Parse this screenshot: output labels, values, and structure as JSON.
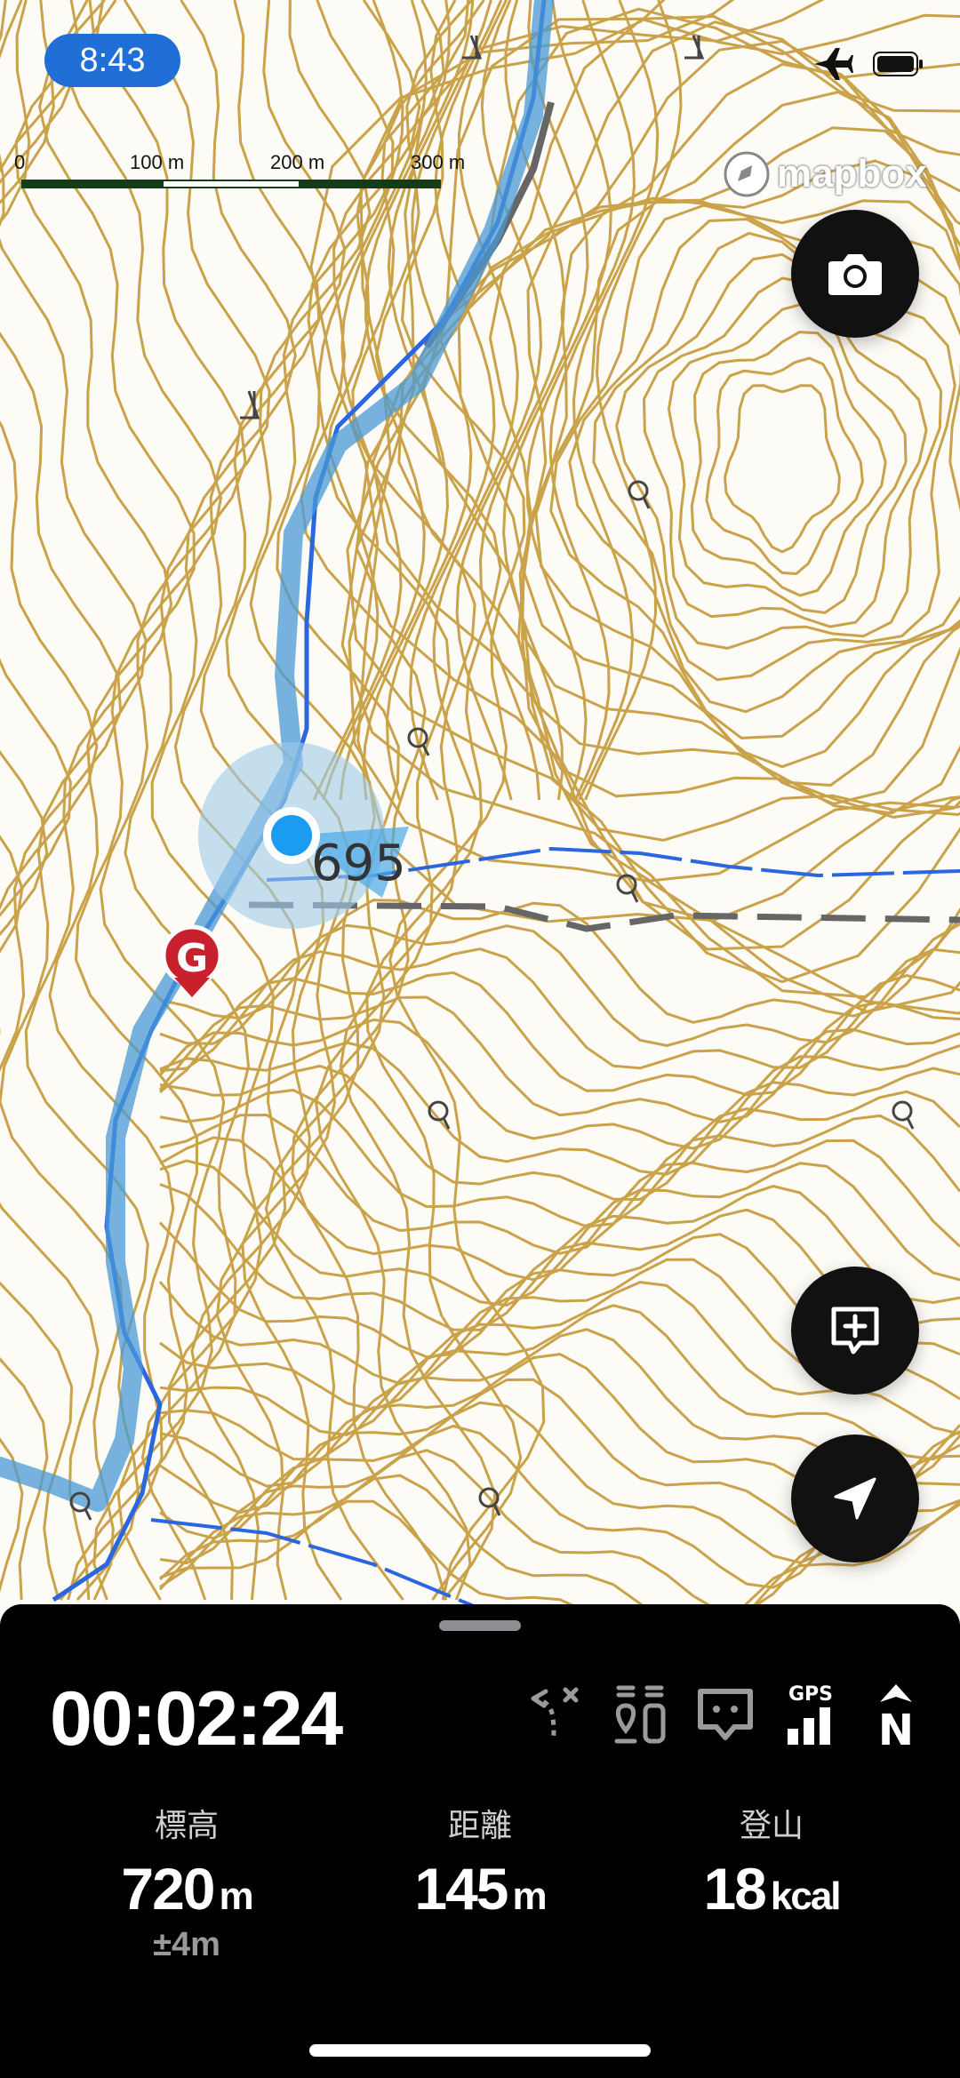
{
  "status_bar": {
    "time": "8:43",
    "airplane_icon": "airplane-icon",
    "battery_icon": "battery-icon"
  },
  "map": {
    "scale_labels": [
      "0",
      "100 m",
      "200 m",
      "300 m"
    ],
    "brand": "mapbox",
    "elevation_label": "695",
    "goal_marker": "G",
    "colors": {
      "contour": "#c9a24a",
      "river": "#2a66e0",
      "route": "#4a9ad6",
      "accuracy": "#9fcbea",
      "location": "#1a9cf0",
      "goal": "#c8202c"
    }
  },
  "buttons": {
    "camera": "camera-icon",
    "add_note": "add-note-icon",
    "locate": "navigation-arrow-icon"
  },
  "panel": {
    "elapsed_time": "00:02:24",
    "icons": [
      "route-off-icon",
      "pins-icon",
      "chat-icon",
      "gps-signal-icon",
      "north-up-icon"
    ],
    "gps_label": "GPS",
    "north_label": "N",
    "stats": [
      {
        "label": "標高",
        "value": "720",
        "unit": "m",
        "sub": "±4m"
      },
      {
        "label": "距離",
        "value": "145",
        "unit": "m",
        "sub": ""
      },
      {
        "label": "登山",
        "value": "18",
        "unit": "kcal",
        "sub": ""
      }
    ]
  }
}
